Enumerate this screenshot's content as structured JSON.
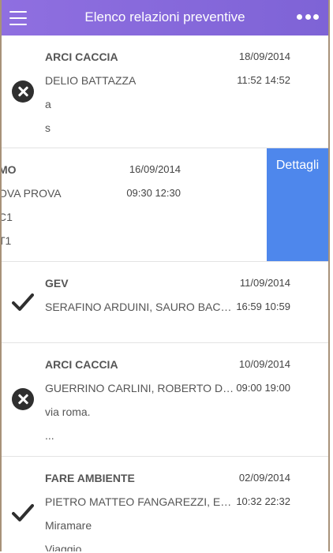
{
  "header": {
    "title": "Elenco relazioni preventive",
    "menu_icon": "hamburger-menu-icon",
    "more_icon": "more-dots-icon"
  },
  "colors": {
    "header": "#7e63d6",
    "details": "#4e87ec"
  },
  "items": [
    {
      "status": "x-circle-icon",
      "org": "ARCI CACCIA",
      "date": "18/09/2014",
      "people": "DELIO BATTAZZA",
      "times": "11:52 14:52",
      "line3": "a",
      "line4": "s"
    },
    {
      "org": "MO",
      "date": "16/09/2014",
      "people": "OVA PROVA",
      "times": "09:30 12:30",
      "line3": "C1",
      "line4": "T1",
      "details_label": "Dettagli"
    },
    {
      "status": "checkmark-icon",
      "org": "GEV",
      "date": "11/09/2014",
      "people": "SERAFINO ARDUINI, SAURO BACC...",
      "times": "16:59 10:59"
    },
    {
      "status": "x-circle-icon",
      "org": "ARCI CACCIA",
      "date": "10/09/2014",
      "people": "GUERRINO CARLINI, ROBERTO DE...",
      "times": "09:00 19:00",
      "line3": "via roma.",
      "line4": "..."
    },
    {
      "status": "checkmark-icon",
      "org": "FARE AMBIENTE",
      "date": "02/09/2014",
      "people": "PIETRO MATTEO FANGAREZZI, ED...",
      "times": "10:32 22:32",
      "line3": "Miramare",
      "line4": "Viaggio"
    }
  ]
}
